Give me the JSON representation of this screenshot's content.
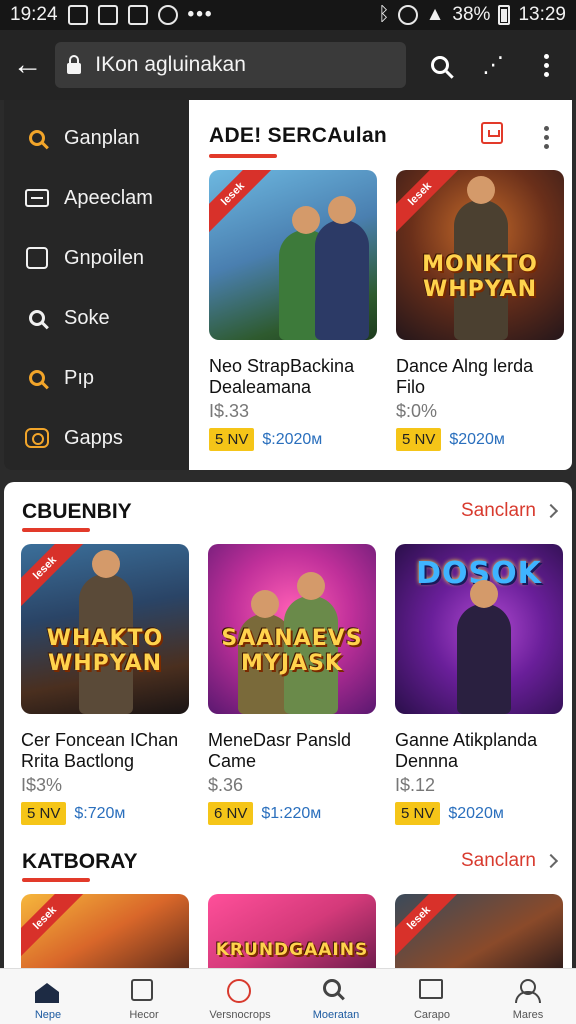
{
  "status_bar": {
    "time_left": "19:24",
    "battery": "38%",
    "time_right": "13:29"
  },
  "app_bar": {
    "url": "IKon agluinakan"
  },
  "drawer": {
    "items": [
      {
        "label": "Ganplan",
        "icon": "search-icon",
        "color": "#f2a52a"
      },
      {
        "label": "Apeeclam",
        "icon": "monitor-icon",
        "color": "#f1f1f1"
      },
      {
        "label": "Gnpoilen",
        "icon": "bag-icon",
        "color": "#f1f1f1"
      },
      {
        "label": "Soke",
        "icon": "search-icon",
        "color": "#f1f1f1"
      },
      {
        "label": "Pıp",
        "icon": "search-icon",
        "color": "#f2a52a"
      },
      {
        "label": "Gapps",
        "icon": "gamepad-icon",
        "color": "#f2a52a"
      }
    ]
  },
  "featured": {
    "title": "ADE! SERCAulan",
    "cards": [
      {
        "ribbon": "lesek",
        "art_text": "",
        "name": "Neo StrapBackina Dealeamana",
        "price": "I$.33",
        "badge": "5 NV",
        "meta_price": "$:2020ᴍ"
      },
      {
        "ribbon": "lesek",
        "art_text": "MONKTO WHPYAN",
        "name": "Dance Alng lerda Filo",
        "price": "$:0%",
        "badge": "5 NV",
        "meta_price": "$2020ᴍ"
      }
    ]
  },
  "section_1": {
    "title": "CBUENBIY",
    "see_all": "Sanclarn",
    "cards": [
      {
        "ribbon": "lesek",
        "art_text": "WHAKTO WHPYAN",
        "name": "Cer Foncean IChan Rrita Bactlong",
        "price": "I$3%",
        "badge": "5 NV",
        "meta_price": "$:720ᴍ"
      },
      {
        "ribbon": "",
        "art_text": "SAANAEVS MYJASK",
        "name": "MeneDasr Pansld Came",
        "price": "$.36",
        "badge": "6 NV",
        "meta_price": "$1:220ᴍ"
      },
      {
        "ribbon": "",
        "art_text": "DOSOK",
        "name": "Ganne Atikplanda Dennna",
        "price": "I$.12",
        "badge": "5 NV",
        "meta_price": "$2020ᴍ"
      }
    ]
  },
  "section_2": {
    "title": "KATBORAY",
    "see_all": "Sanclarn",
    "cards": [
      {
        "ribbon": "lesek",
        "art_text": ""
      },
      {
        "ribbon": "",
        "art_text": "KRUNDGAAINS"
      },
      {
        "ribbon": "lesek",
        "art_text": ""
      }
    ]
  },
  "bottom_nav": {
    "items": [
      {
        "label": "Nepe",
        "icon": "home-icon"
      },
      {
        "label": "Hecor",
        "icon": "bag-icon"
      },
      {
        "label": "Versnocrops",
        "icon": "gamepad-icon"
      },
      {
        "label": "Moeratan",
        "icon": "search-icon"
      },
      {
        "label": "Carapo",
        "icon": "store-icon"
      },
      {
        "label": "Mares",
        "icon": "user-icon"
      }
    ]
  },
  "colors": {
    "accent": "#d83a2e",
    "badge": "#f5c518",
    "link": "#2a6fbd"
  }
}
